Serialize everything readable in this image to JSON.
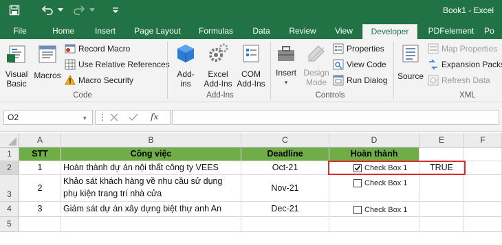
{
  "app": {
    "title": "Book1 - Excel"
  },
  "tabs": [
    {
      "label": "File"
    },
    {
      "label": "Home"
    },
    {
      "label": "Insert"
    },
    {
      "label": "Page Layout"
    },
    {
      "label": "Formulas"
    },
    {
      "label": "Data"
    },
    {
      "label": "Review"
    },
    {
      "label": "View"
    },
    {
      "label": "Developer"
    },
    {
      "label": "PDFelement"
    },
    {
      "label": "Po"
    }
  ],
  "active_tab": "Developer",
  "ribbon": {
    "code": {
      "visual_basic": "Visual Basic",
      "macros": "Macros",
      "record_macro": "Record Macro",
      "relative_refs": "Use Relative References",
      "macro_security": "Macro Security",
      "label": "Code"
    },
    "addins": {
      "addins": "Add-ins",
      "excel_addins": "Excel Add-Ins",
      "com_addins": "COM Add-Ins",
      "label": "Add-Ins"
    },
    "controls": {
      "insert": "Insert",
      "design_mode": "Design Mode",
      "properties": "Properties",
      "view_code": "View Code",
      "run_dialog": "Run Dialog",
      "label": "Controls"
    },
    "xml": {
      "source": "Source",
      "map_properties": "Map Properties",
      "expansion_packs": "Expansion Packs",
      "refresh_data": "Refresh Data",
      "label": "XML"
    }
  },
  "formula_bar": {
    "name_box": "O2",
    "fx": "fx",
    "formula": ""
  },
  "columns": [
    "A",
    "B",
    "C",
    "D",
    "E",
    "F"
  ],
  "rows": [
    "1",
    "2",
    "3",
    "4",
    "5"
  ],
  "table": {
    "headers": [
      "STT",
      "Công việc",
      "Deadline",
      "Hoàn thành"
    ],
    "rows": [
      {
        "stt": "1",
        "task": "Hoàn thành dự án nội thất công ty VEES",
        "task2": "",
        "deadline": "Oct-21",
        "checkbox": "Check Box 1",
        "checked": true,
        "result": "TRUE"
      },
      {
        "stt": "2",
        "task": "Khảo sát khách hàng về nhu cầu sử dụng",
        "task2": "phụ kiện trang trí nhà cửa",
        "deadline": "Nov-21",
        "checkbox": "Check Box 1",
        "checked": false,
        "result": ""
      },
      {
        "stt": "3",
        "task": "Giám sát dự án xây dựng biệt thự anh An",
        "task2": "",
        "deadline": "Dec-21",
        "checkbox": "Check Box 1",
        "checked": false,
        "result": ""
      }
    ]
  },
  "colors": {
    "excel_green": "#217346",
    "header_fill": "#70ad47",
    "highlight_border": "#e0292e"
  }
}
